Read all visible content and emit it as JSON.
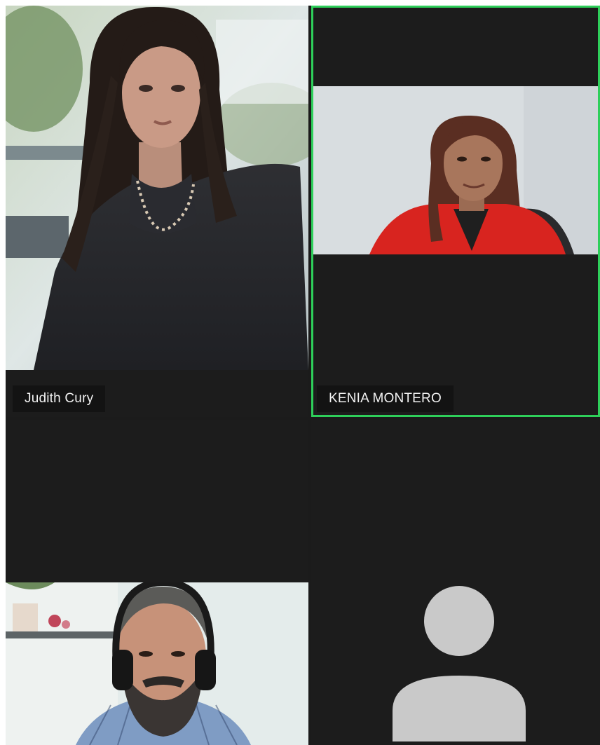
{
  "meeting": {
    "view": "gallery",
    "active_speaker_color": "#2ecf5a",
    "participants": [
      {
        "name": "Judith Cury",
        "video": "on",
        "active_speaker": false
      },
      {
        "name": "KENIA MONTERO",
        "video": "on",
        "active_speaker": true
      },
      {
        "name": "",
        "video": "on",
        "active_speaker": false
      },
      {
        "name": "",
        "video": "off",
        "avatar_icon": "person-silhouette-icon",
        "active_speaker": false
      }
    ]
  }
}
